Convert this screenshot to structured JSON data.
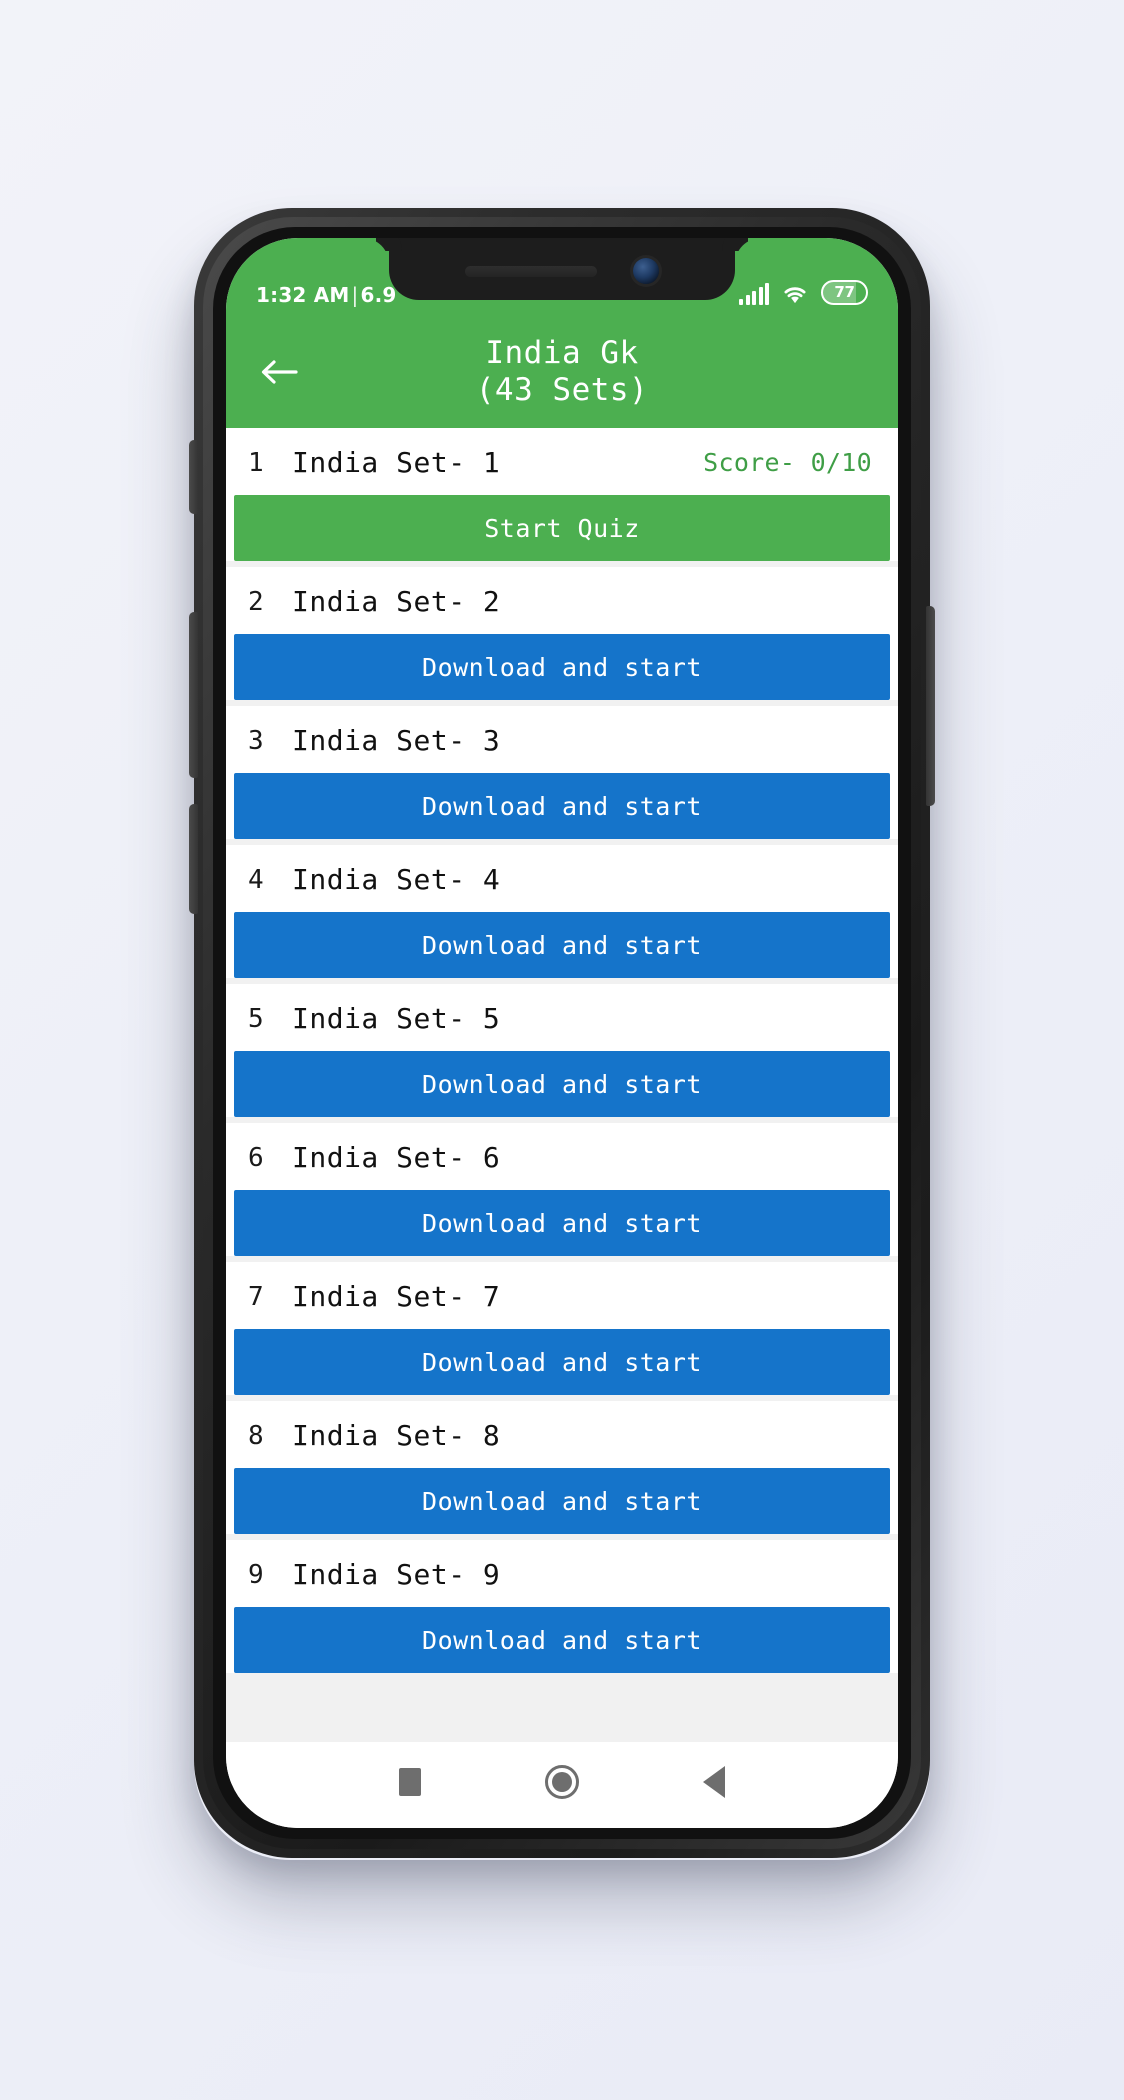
{
  "status_bar": {
    "time": "1:32 AM",
    "separator": "|",
    "data_rate": "6.9",
    "signal_icon": "signal-bars-icon",
    "wifi_icon": "wifi-icon",
    "battery_level": "77"
  },
  "app_bar": {
    "back_icon": "back-arrow-icon",
    "title": "India Gk",
    "subtitle": "(43 Sets)"
  },
  "colors": {
    "primary_green": "#4caf50",
    "action_blue": "#1574ca",
    "score_green": "#3f9e46",
    "page_background": "#f2f3f9"
  },
  "list": {
    "items": [
      {
        "index": "1",
        "name": "India Set- 1",
        "score": "Score- 0/10",
        "action_label": "Start Quiz",
        "action_style": "green"
      },
      {
        "index": "2",
        "name": "India Set- 2",
        "score": "",
        "action_label": "Download and start",
        "action_style": "blue"
      },
      {
        "index": "3",
        "name": "India Set- 3",
        "score": "",
        "action_label": "Download and start",
        "action_style": "blue"
      },
      {
        "index": "4",
        "name": "India Set- 4",
        "score": "",
        "action_label": "Download and start",
        "action_style": "blue"
      },
      {
        "index": "5",
        "name": "India Set- 5",
        "score": "",
        "action_label": "Download and start",
        "action_style": "blue"
      },
      {
        "index": "6",
        "name": "India Set- 6",
        "score": "",
        "action_label": "Download and start",
        "action_style": "blue"
      },
      {
        "index": "7",
        "name": "India Set- 7",
        "score": "",
        "action_label": "Download and start",
        "action_style": "blue"
      },
      {
        "index": "8",
        "name": "India Set- 8",
        "score": "",
        "action_label": "Download and start",
        "action_style": "blue"
      },
      {
        "index": "9",
        "name": "India Set- 9",
        "score": "",
        "action_label": "Download and start",
        "action_style": "blue"
      }
    ]
  },
  "nav_bar": {
    "recents_icon": "square-recents-icon",
    "home_icon": "circle-home-icon",
    "back_icon": "triangle-back-icon"
  }
}
